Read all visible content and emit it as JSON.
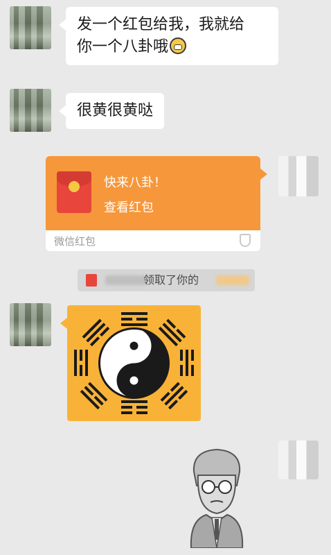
{
  "messages": {
    "msg1": {
      "line1": "发一个红包给我，我就给",
      "line2": "你一个八卦哦"
    },
    "msg2": {
      "text": "很黄很黄哒"
    },
    "red_packet": {
      "title": "快来八卦！",
      "subtitle": "查看红包",
      "label": "微信红包"
    },
    "notice": {
      "text": "领取了你的"
    }
  },
  "colors": {
    "background": "#e9e9e9",
    "red_packet_orange": "#f6973b",
    "bagua_yellow": "#f9b238"
  },
  "icons": {
    "emoji": "grinning-emoji-icon",
    "envelope": "red-envelope-icon",
    "shield": "shield-icon"
  }
}
